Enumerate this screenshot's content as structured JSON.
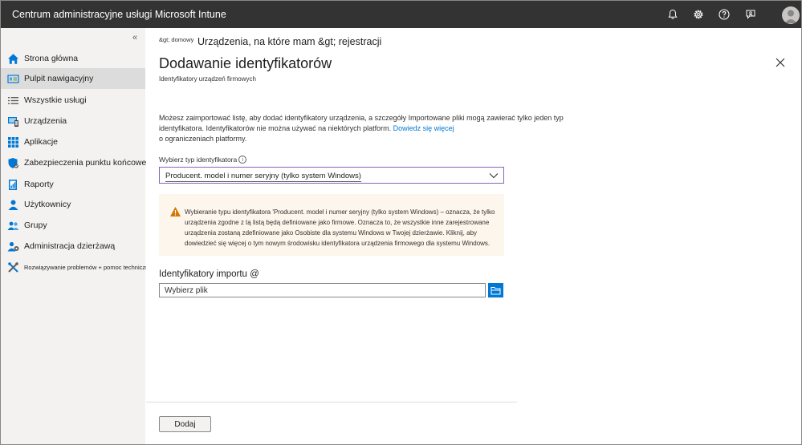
{
  "app": {
    "title": "Centrum administracyjne usługi Microsoft Intune"
  },
  "topbar": {
    "icons": [
      "bell-icon",
      "gear-icon",
      "help-icon",
      "feedback-icon",
      "avatar"
    ]
  },
  "sidebar": {
    "collapse_glyph": "«",
    "items": [
      {
        "label": "Strona główna",
        "icon": "home-icon",
        "active": false
      },
      {
        "label": "Pulpit nawigacyjny",
        "icon": "dashboard-icon",
        "active": true
      },
      {
        "label": "Wszystkie usługi",
        "icon": "list-icon",
        "active": false
      },
      {
        "label": "Urządzenia",
        "icon": "devices-icon",
        "active": false
      },
      {
        "label": "Aplikacje",
        "icon": "apps-grid-icon",
        "active": false
      },
      {
        "label": "Zabezpieczenia punktu końcowego",
        "icon": "shield-icon",
        "active": false
      },
      {
        "label": "Raporty",
        "icon": "reports-icon",
        "active": false
      },
      {
        "label": "Użytkownicy",
        "icon": "user-icon",
        "active": false
      },
      {
        "label": "Grupy",
        "icon": "groups-icon",
        "active": false
      },
      {
        "label": "Administracja dzierżawą",
        "icon": "tenant-admin-icon",
        "active": false
      },
      {
        "label": "Rozwiązywanie problemów + pomoc techniczna",
        "icon": "troubleshoot-icon",
        "active": false
      }
    ]
  },
  "breadcrumb": {
    "first": "&gt; domowy",
    "second": "Urządzenia, na które mam &gt; rejestracji"
  },
  "page": {
    "title": "Dodawanie identyfikatorów",
    "subtitle": "Identyfikatory urządzeń firmowych"
  },
  "description": {
    "text": "Możesz zaimportować listę, aby dodać identyfikatory urządzenia, a szczegóły Importowane pliki mogą zawierać tylko jeden typ identyfikatora. Identyfikatorów nie można używać na niektórych platform.",
    "link": "Dowiedz się więcej",
    "line2": "o ograniczeniach platformy."
  },
  "identifier_type": {
    "label": "Wybierz typ identyfikatora",
    "info_glyph": "i",
    "selected": "Producent. model i numer seryjny (tylko system Windows)"
  },
  "warning": {
    "text": "Wybieranie typu identyfikatora 'Producent. model i numer seryjny (tylko system Windows) – oznacza, że tylko urządzenia zgodne z tą listą będą definiowane jako firmowe. Oznacza to, że wszystkie inne zarejestrowane urządzenia zostaną zdefiniowane jako Osobiste dla systemu Windows w Twojej dzierżawie. Kliknij, aby dowiedzieć się więcej o tym nowym środowisku identyfikatora urządzenia firmowego dla systemu Windows."
  },
  "import": {
    "label": "Identyfikatory importu @",
    "placeholder": "Wybierz plik"
  },
  "footer": {
    "add_label": "Dodaj"
  },
  "colors": {
    "topbar": "#333333",
    "sidebar": "#f3f2f1",
    "accent": "#0078d4",
    "select_border": "#8764b8",
    "warning_bg": "#fdf6ed",
    "warning_icon": "#d47500"
  }
}
